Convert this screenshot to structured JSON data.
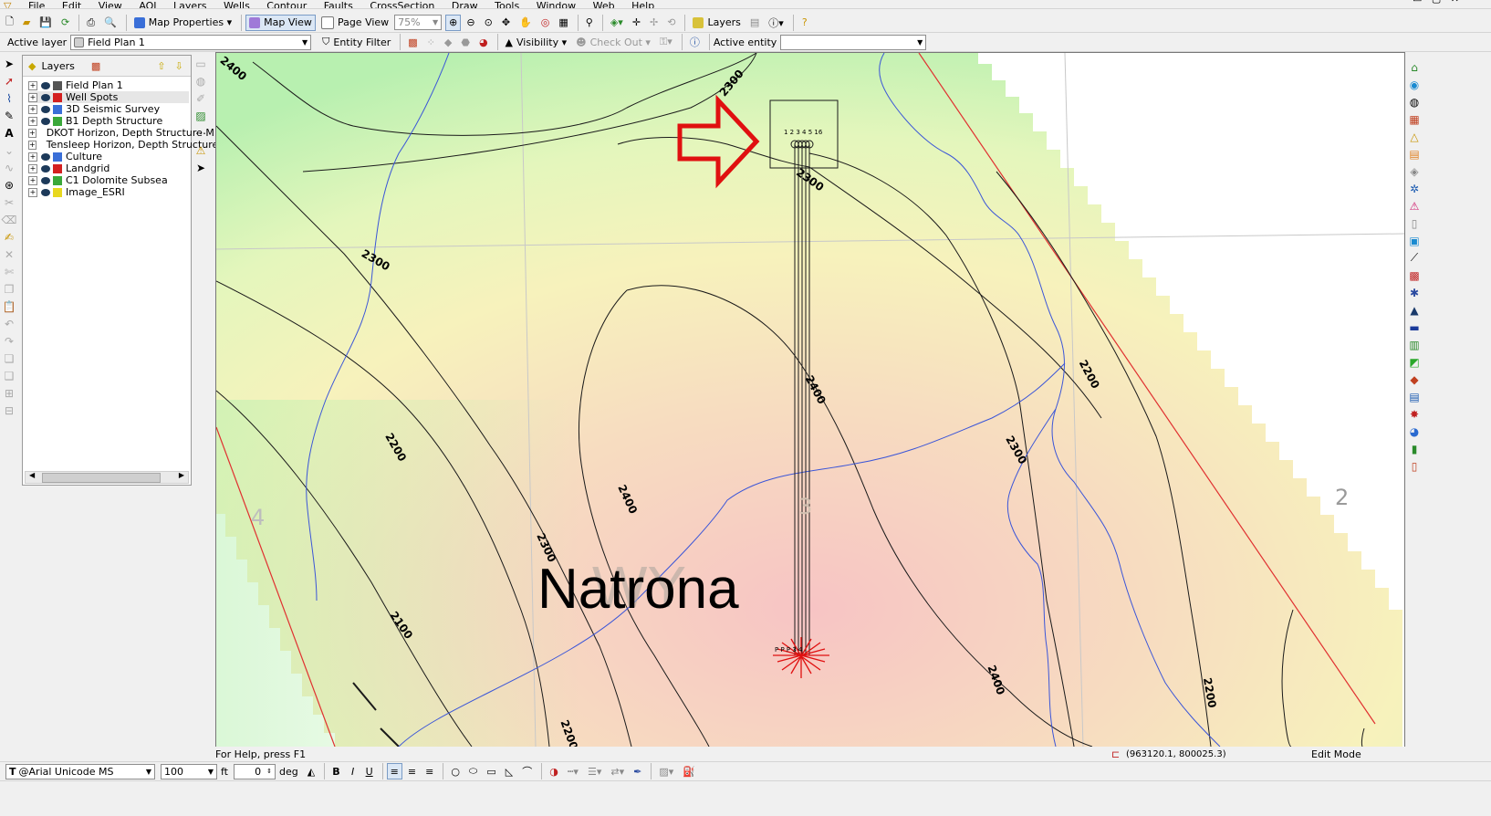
{
  "menu": [
    "File",
    "Edit",
    "View",
    "AOI",
    "Layers",
    "Wells",
    "Contour",
    "Faults",
    "CrossSection",
    "Draw",
    "Tools",
    "Window",
    "Web",
    "Help"
  ],
  "toolbar1": {
    "map_properties": "Map Properties",
    "map_view": "Map View",
    "page_view": "Page View",
    "zoom": "75%",
    "layers": "Layers"
  },
  "toolbar2": {
    "active_layer_label": "Active layer",
    "active_layer_value": "Field Plan 1",
    "entity_filter": "Entity Filter",
    "visibility": "Visibility",
    "check_out": "Check Out",
    "active_entity_label": "Active entity",
    "active_entity_value": ""
  },
  "layers_panel": {
    "title": "Layers",
    "items": [
      {
        "label": "Field Plan 1",
        "color": "#555555"
      },
      {
        "label": "Well Spots",
        "color": "#d42020"
      },
      {
        "label": "3D Seismic Survey",
        "color": "#3a6fd8"
      },
      {
        "label": "B1 Depth Structure",
        "color": "#3aa83a"
      },
      {
        "label": "DKOT Horizon, Depth Structure M",
        "color": "#3aa83a"
      },
      {
        "label": "Tensleep Horizon, Depth Structure",
        "color": "#3aa83a"
      },
      {
        "label": "Culture",
        "color": "#3a6fd8"
      },
      {
        "label": "Landgrid",
        "color": "#d42020"
      },
      {
        "label": "C1 Dolomite Subsea",
        "color": "#3aa83a"
      },
      {
        "label": "Image_ESRI",
        "color": "#e8d820"
      }
    ]
  },
  "map": {
    "county_label": "Natrona",
    "state_label": "WY",
    "section_labels": [
      "4",
      "3",
      "2"
    ],
    "contour_labels": [
      "2400",
      "2300",
      "2300",
      "2300",
      "2200",
      "2400",
      "2400",
      "2300",
      "2200",
      "2300",
      "2100",
      "2200",
      "2400",
      "2200",
      "2300",
      "2200"
    ],
    "well_labels_top": "1 2 3 4 5 16",
    "well_labels_bottom": "P P P 3 4"
  },
  "status_bar": {
    "help": "For Help, press F1",
    "coords": "(963120.1, 800025.3)",
    "mode": "Edit Mode"
  },
  "format_bar": {
    "font": "@Arial Unicode MS",
    "size": "100",
    "unit": "ft",
    "angle": "0",
    "angle_unit": "deg"
  },
  "colors": {
    "arrow": "#e01010",
    "river": "#3a55d8",
    "contour": "#1a1a1a",
    "fault": "#e03030"
  }
}
